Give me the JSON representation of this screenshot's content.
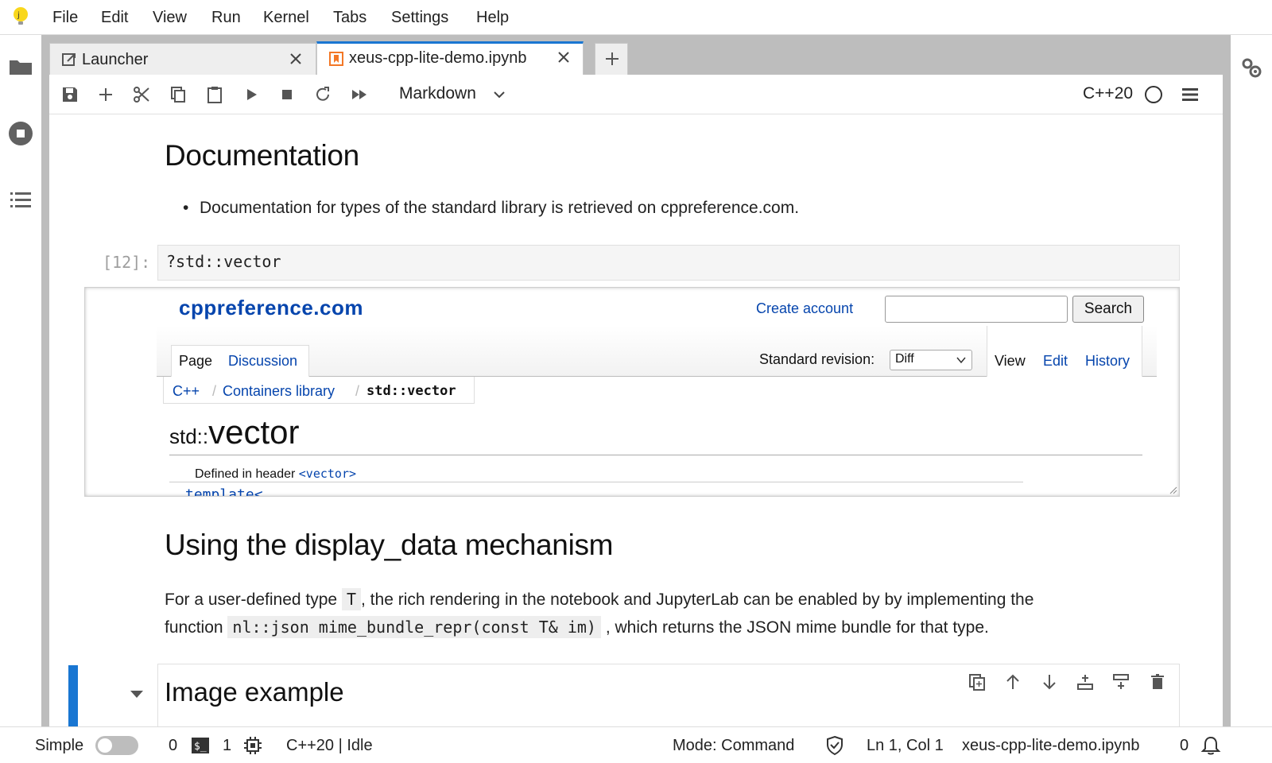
{
  "menubar": {
    "items": [
      "File",
      "Edit",
      "View",
      "Run",
      "Kernel",
      "Tabs",
      "Settings",
      "Help"
    ]
  },
  "tabs": [
    {
      "label": "Launcher",
      "icon": "launcher-icon"
    },
    {
      "label": "xeus-cpp-lite-demo.ipynb",
      "icon": "notebook-icon",
      "active": true
    }
  ],
  "toolbar": {
    "cell_type": "Markdown",
    "kernel_name": "C++20"
  },
  "notebook": {
    "heading1": "Documentation",
    "bullet1": "Documentation for types of the standard library is retrieved on cppreference.com.",
    "cell_prompt": "[12]:",
    "cell_code": "?std::vector",
    "heading2": "Using the display_data mechanism",
    "para_part1": "For a user-defined type",
    "para_code1": "T",
    "para_part2": ", the rich rendering in the notebook and JupyterLab can be enabled by by implementing the",
    "para_part3": "function",
    "para_code2": "nl::json mime_bundle_repr(const T& im)",
    "para_part4": ", which returns the JSON mime bundle for that type.",
    "heading3": "Image example"
  },
  "cppref": {
    "logo": "cppreference.com",
    "create_account": "Create account",
    "search_button": "Search",
    "tab_page": "Page",
    "tab_discussion": "Discussion",
    "standard_revision_label": "Standard revision:",
    "standard_revision_value": "Diff",
    "tab_view": "View",
    "tab_edit": "Edit",
    "tab_history": "History",
    "crumb1": "C++",
    "crumb2": "Containers library",
    "crumb3": "std::vector",
    "heading_ns": "std::",
    "heading_name": "vector",
    "defined_in": "Defined in header",
    "header_name": "<vector>",
    "template_kw": "template<"
  },
  "statusbar": {
    "mode_label": "Simple",
    "terminals_count": "0",
    "kernels_count": "1",
    "kernel_state": "C++20 | Idle",
    "mode": "Mode: Command",
    "cursor": "Ln 1, Col 1",
    "filename": "xeus-cpp-lite-demo.ipynb",
    "notifications": "0"
  },
  "colors": {
    "accent": "#1976d2",
    "link": "#0645ad",
    "notebook_icon": "#f37726"
  }
}
